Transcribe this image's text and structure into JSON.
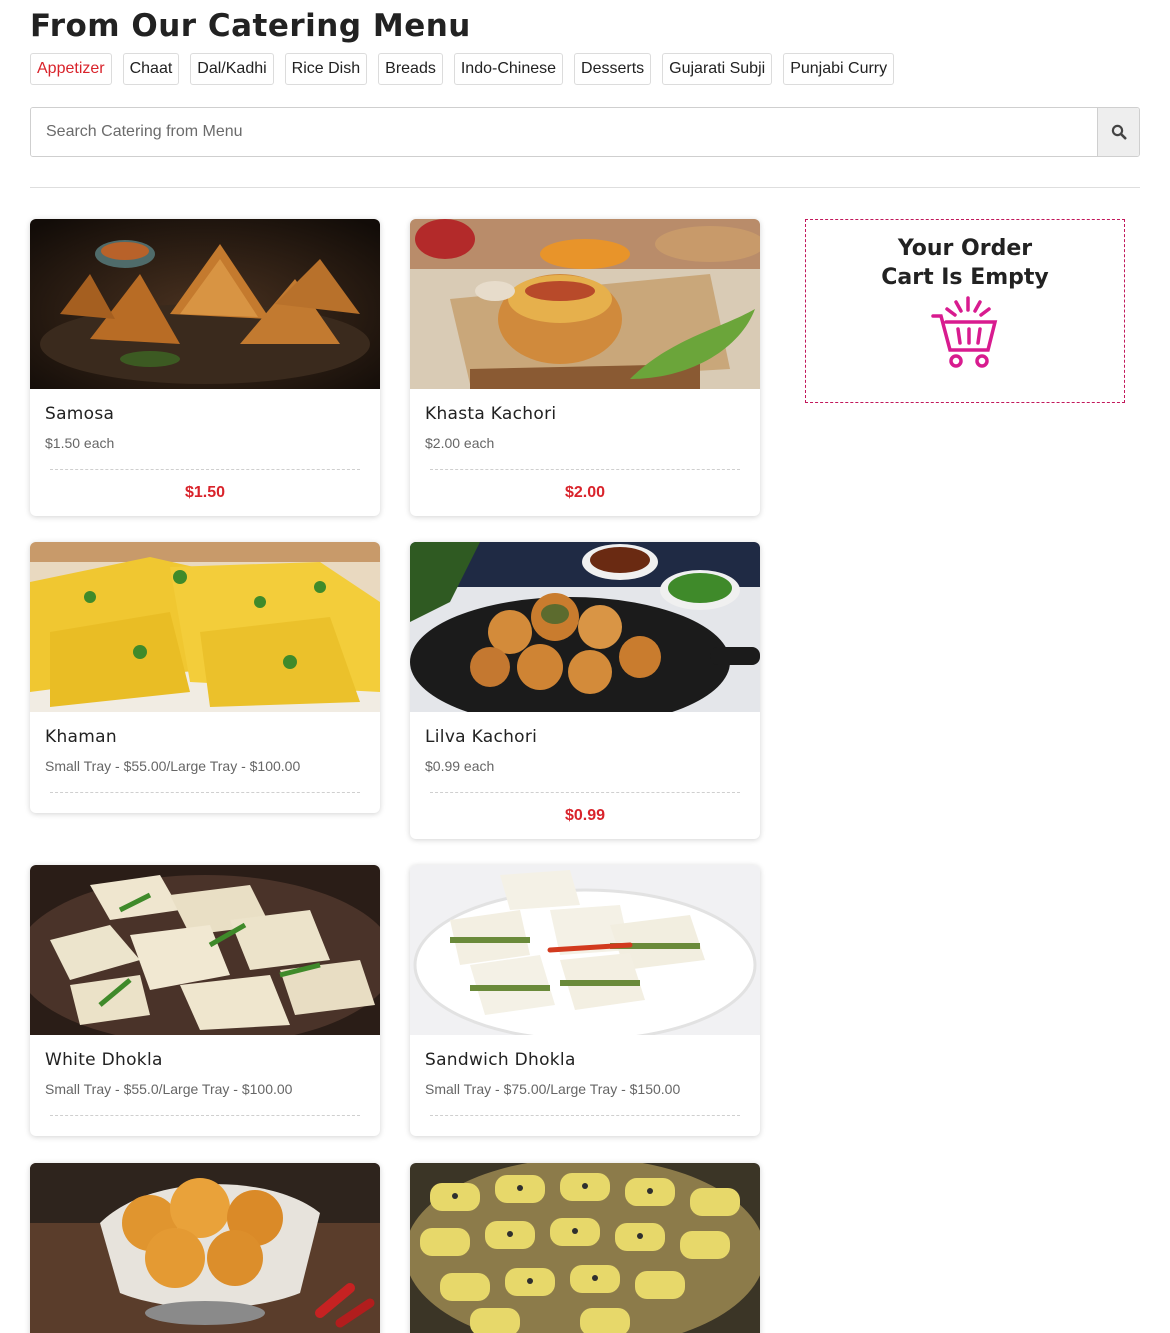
{
  "header": {
    "title": "From Our Catering Menu"
  },
  "categories": [
    {
      "label": "Appetizer",
      "active": true
    },
    {
      "label": "Chaat"
    },
    {
      "label": "Dal/Kadhi"
    },
    {
      "label": "Rice Dish"
    },
    {
      "label": "Breads"
    },
    {
      "label": "Indo-Chinese"
    },
    {
      "label": "Desserts"
    },
    {
      "label": "Gujarati Subji"
    },
    {
      "label": "Punjabi Curry"
    }
  ],
  "search": {
    "placeholder": "Search Catering from Menu",
    "icon": "search-icon"
  },
  "items": [
    {
      "name": "Samosa",
      "desc": "$1.50 each",
      "price": "$1.50"
    },
    {
      "name": "Khasta Kachori",
      "desc": "$2.00 each",
      "price": "$2.00"
    },
    {
      "name": "Khaman",
      "desc": "Small Tray - $55.00/Large Tray - $100.00",
      "price": ""
    },
    {
      "name": "Lilva Kachori",
      "desc": "$0.99 each",
      "price": "$0.99"
    },
    {
      "name": "White Dhokla",
      "desc": "Small Tray - $55.0/Large Tray - $100.00",
      "price": ""
    },
    {
      "name": "Sandwich Dhokla",
      "desc": "Small Tray - $75.00/Large Tray - $150.00",
      "price": ""
    }
  ],
  "cart": {
    "line1": "Your Order",
    "line2": "Cart Is Empty",
    "icon": "cart-icon"
  },
  "colors": {
    "accent": "#d9232b",
    "cart_border": "#c2185b",
    "cart_icon": "#d81b8f"
  }
}
